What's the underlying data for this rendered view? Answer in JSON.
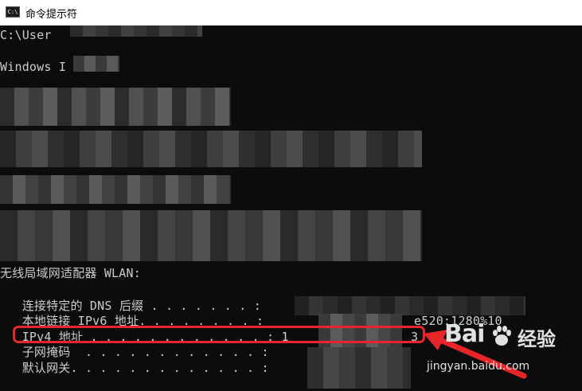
{
  "window": {
    "title": "命令提示符",
    "icon_text": "C:\\"
  },
  "console": {
    "lines": [
      "C:\\User",
      "Windows I",
      "无线局域网适配器 WLAN:",
      "   连接特定的 DNS 后缀 . . . . . . . :",
      "   本地链接 IPv6 地址. . . . . . . . :",
      "   IPv4 地址 . . . . . . . . . . . . : 1",
      "   子网掩码  . . . . . . . . . . . . :",
      "   默认网关. . . . . . . . . . . . . :"
    ],
    "ipv6_tail": "e520:1280%10",
    "ipv4_tail": "3"
  },
  "watermark": {
    "brand": "Bai",
    "brand_suffix": "经验",
    "url": "jingyan.baidu.com"
  },
  "colors": {
    "console_bg": "#0c0c0c",
    "console_text": "#cccccc",
    "highlight": "#e8262a"
  }
}
